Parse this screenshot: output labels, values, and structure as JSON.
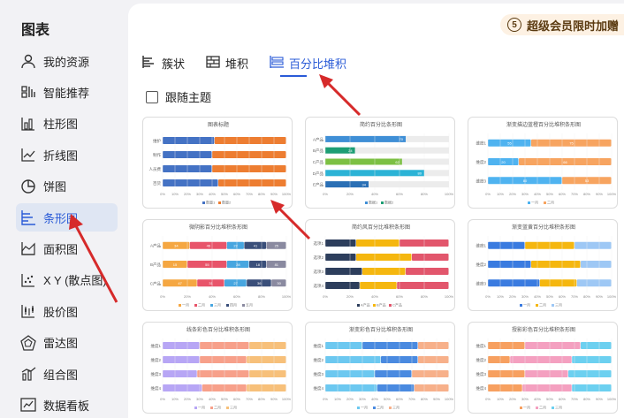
{
  "sidebar": {
    "title": "图表",
    "items": [
      {
        "label": "我的资源",
        "icon": "user-icon"
      },
      {
        "label": "智能推荐",
        "icon": "smart-recommend-icon"
      },
      {
        "label": "柱形图",
        "icon": "column-chart-icon"
      },
      {
        "label": "折线图",
        "icon": "line-chart-icon"
      },
      {
        "label": "饼图",
        "icon": "pie-chart-icon"
      },
      {
        "label": "条形图",
        "icon": "bar-chart-icon",
        "active": true
      },
      {
        "label": "面积图",
        "icon": "area-chart-icon"
      },
      {
        "label": "X Y (散点图)",
        "icon": "scatter-chart-icon"
      },
      {
        "label": "股价图",
        "icon": "stock-chart-icon"
      },
      {
        "label": "雷达图",
        "icon": "radar-chart-icon"
      },
      {
        "label": "组合图",
        "icon": "combo-chart-icon"
      },
      {
        "label": "数据看板",
        "icon": "dashboard-icon"
      }
    ]
  },
  "promo": {
    "text": "超级会员限时加赠",
    "icon_text": "5"
  },
  "tabs": [
    {
      "label": "簇状"
    },
    {
      "label": "堆积"
    },
    {
      "label": "百分比堆积",
      "active": true
    }
  ],
  "follow_theme": {
    "label": "跟随主题",
    "checked": false
  },
  "thumbnails": [
    {
      "title": "图表标题",
      "rows": [
        "维护",
        "制作",
        "人员费",
        "百货"
      ],
      "legend": [
        "数量1",
        "数量2"
      ],
      "colors": [
        "#4472c4",
        "#ed7d31"
      ],
      "split": [
        [
          0.42,
          0.58
        ],
        [
          0.4,
          0.6
        ],
        [
          0.4,
          0.6
        ],
        [
          0.45,
          0.55
        ]
      ],
      "ticks": [
        "0%",
        "10%",
        "20%",
        "30%",
        "40%",
        "50%",
        "60%",
        "70%",
        "80%",
        "90%",
        "100%"
      ]
    },
    {
      "title": "简约百分比条形图",
      "rows": [
        "A产品",
        "B产品",
        "C产品",
        "D产品",
        "E产品"
      ],
      "legend": [
        "数据1",
        "数据2"
      ],
      "colors": [
        "#3f8fd6",
        "#1d9e74",
        "#7cc043",
        "#2bb3d6",
        "#2a6fb5"
      ],
      "fills": [
        0.65,
        0.24,
        0.62,
        0.8,
        0.35
      ],
      "labels": [
        "70",
        "24",
        "62",
        "80",
        "34"
      ],
      "ticks": [
        "0%",
        "20%",
        "40%",
        "60%",
        "80%",
        "100%"
      ]
    },
    {
      "title": "渐变描边蓝橙百分比堆积条形图",
      "rows": [
        "维度1",
        "维度2",
        "维度3"
      ],
      "legend": [
        "一月",
        "二月"
      ],
      "colors": [
        "#4fb3f0",
        "#f7a460"
      ],
      "split": [
        [
          0.35,
          0.65
        ],
        [
          0.25,
          0.75
        ],
        [
          0.6,
          0.4
        ]
      ],
      "labels": [
        [
          "55",
          "75"
        ],
        [
          "20",
          "66"
        ],
        [
          "80",
          "53"
        ]
      ],
      "ticks": [
        "0%",
        "10%",
        "20%",
        "30%",
        "40%",
        "50%",
        "60%",
        "70%",
        "80%",
        "90%",
        "100%"
      ]
    },
    {
      "title": "微阴影百分比堆积条形图",
      "rows": [
        "A产品",
        "B产品",
        "C产品"
      ],
      "legend": [
        "一月",
        "二月",
        "三月",
        "四月",
        "五月"
      ],
      "colors": [
        "#f5a742",
        "#e8546a",
        "#47a6e0",
        "#3a4f7a",
        "#8a8aa0"
      ],
      "split": [
        [
          0.22,
          0.3,
          0.14,
          0.18,
          0.16
        ],
        [
          0.2,
          0.32,
          0.18,
          0.14,
          0.16
        ],
        [
          0.28,
          0.22,
          0.18,
          0.2,
          0.12
        ]
      ],
      "labels": [
        [
          "34",
          "46",
          "22",
          "41",
          "25"
        ],
        [
          "15",
          "55",
          "28",
          "18",
          "81"
        ],
        [
          "47",
          "31",
          "27",
          "36",
          "30"
        ]
      ],
      "ticks": [
        "0%",
        "20%",
        "40%",
        "60%",
        "80%",
        "100%"
      ]
    },
    {
      "title": "简约风百分比堆积条形图",
      "rows": [
        "选项1",
        "选项2",
        "选项3",
        "选项4"
      ],
      "legend": [
        "A产品",
        "B产品",
        "C产品"
      ],
      "colors": [
        "#2d3e5c",
        "#f5b70f",
        "#e2566c"
      ],
      "split": [
        [
          0.25,
          0.35,
          0.4
        ],
        [
          0.25,
          0.45,
          0.3
        ],
        [
          0.3,
          0.35,
          0.35
        ],
        [
          0.28,
          0.3,
          0.42
        ]
      ],
      "ticks": [
        "0%",
        "20%",
        "40%",
        "60%",
        "80%",
        "100%"
      ]
    },
    {
      "title": "渐变蓝黄百分比堆积条形图",
      "rows": [
        "维度1",
        "维度2",
        "维度3"
      ],
      "legend": [
        "一月",
        "二月",
        "三月"
      ],
      "colors": [
        "#3a7be0",
        "#f5b70f",
        "#9ec8f5"
      ],
      "split": [
        [
          0.3,
          0.4,
          0.3
        ],
        [
          0.35,
          0.4,
          0.25
        ],
        [
          0.42,
          0.3,
          0.28
        ]
      ],
      "ticks": [
        "0%",
        "10%",
        "20%",
        "30%",
        "40%",
        "50%",
        "60%",
        "70%",
        "80%",
        "90%",
        "100%"
      ]
    },
    {
      "title": "线条彩色百分比堆积条形图",
      "rows": [
        "维度1",
        "维度2",
        "维度3",
        "维度4"
      ],
      "legend": [
        "一月",
        "二月",
        "三月"
      ],
      "colors": [
        "#b7a6f5",
        "#f7a08a",
        "#f7c07a"
      ],
      "split": [
        [
          0.3,
          0.4,
          0.3
        ],
        [
          0.3,
          0.38,
          0.32
        ],
        [
          0.28,
          0.42,
          0.3
        ],
        [
          0.32,
          0.36,
          0.32
        ]
      ],
      "ticks": [
        "0%",
        "10%",
        "20%",
        "30%",
        "40%",
        "50%",
        "60%",
        "70%",
        "80%",
        "90%",
        "100%"
      ]
    },
    {
      "title": "渐变彩色百分比堆积条形图",
      "rows": [
        "维度1",
        "维度2",
        "维度3",
        "维度4"
      ],
      "legend": [
        "一月",
        "二月",
        "三月"
      ],
      "colors": [
        "#6cc8f0",
        "#4a8ae0",
        "#f7b08a"
      ],
      "split": [
        [
          0.3,
          0.45,
          0.25
        ],
        [
          0.45,
          0.3,
          0.25
        ],
        [
          0.4,
          0.3,
          0.3
        ],
        [
          0.42,
          0.3,
          0.28
        ]
      ],
      "ticks": [
        "0%",
        "10%",
        "20%",
        "30%",
        "40%",
        "50%",
        "60%",
        "70%",
        "80%",
        "90%",
        "100%"
      ]
    },
    {
      "title": "授影彩色百分比堆积条形图",
      "rows": [
        "维度1",
        "维度2",
        "维度3",
        "维度4"
      ],
      "legend": [
        "一月",
        "二月",
        "三月"
      ],
      "colors": [
        "#f7a060",
        "#f4a0c0",
        "#6cd0f0"
      ],
      "split": [
        [
          0.3,
          0.45,
          0.25
        ],
        [
          0.18,
          0.5,
          0.32
        ],
        [
          0.3,
          0.35,
          0.35
        ],
        [
          0.28,
          0.4,
          0.32
        ]
      ],
      "ticks": [
        "0%",
        "10%",
        "20%",
        "30%",
        "40%",
        "50%",
        "60%",
        "70%",
        "80%",
        "90%",
        "100%"
      ]
    }
  ]
}
